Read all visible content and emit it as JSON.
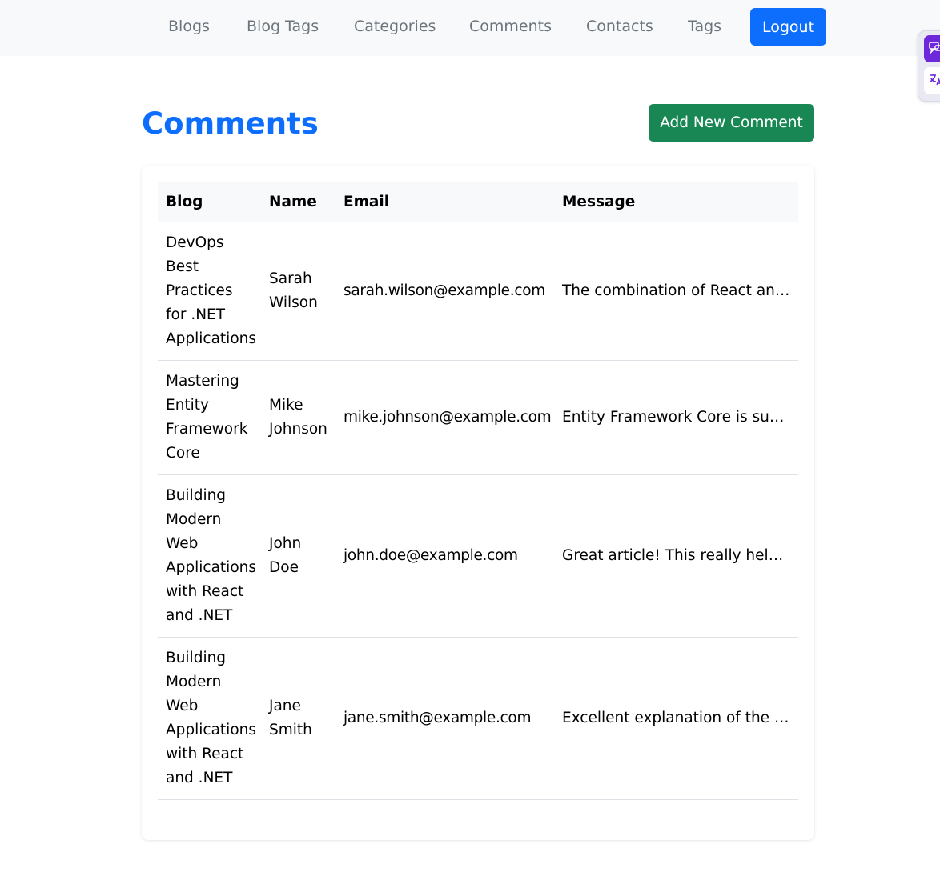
{
  "nav": {
    "links": [
      "Blogs",
      "Blog Tags",
      "Categories",
      "Comments",
      "Contacts",
      "Tags"
    ],
    "logout_label": "Logout"
  },
  "page": {
    "title": "Comments",
    "add_button_label": "Add New Comment"
  },
  "table": {
    "headers": {
      "blog": "Blog",
      "name": "Name",
      "email": "Email",
      "message": "Message"
    },
    "rows": [
      {
        "blog": "DevOps Best Practices for .NET Applications",
        "name": "Sarah Wilson",
        "email": "sarah.wilson@example.com",
        "message": "The combination of React and ...."
      },
      {
        "blog": "Mastering Entity Framework Core",
        "name": "Mike Johnson",
        "email": "mike.johnson@example.com",
        "message": "Entity Framework Core is such ..."
      },
      {
        "blog": "Building Modern Web Applications with React and .NET",
        "name": "John Doe",
        "email": "john.doe@example.com",
        "message": "Great article! This really helped ..."
      },
      {
        "blog": "Building Modern Web Applications with React and .NET",
        "name": "Jane Smith",
        "email": "jane.smith@example.com",
        "message": "Excellent explanation of the ne..."
      }
    ]
  },
  "extension": {
    "top_icon": "chat-bubble-icon",
    "bottom_icon": "translate-icon",
    "accent_color": "#6d28d9"
  },
  "colors": {
    "primary": "#0d6efd",
    "success": "#198754",
    "navbar_bg": "#f8f9fa"
  }
}
